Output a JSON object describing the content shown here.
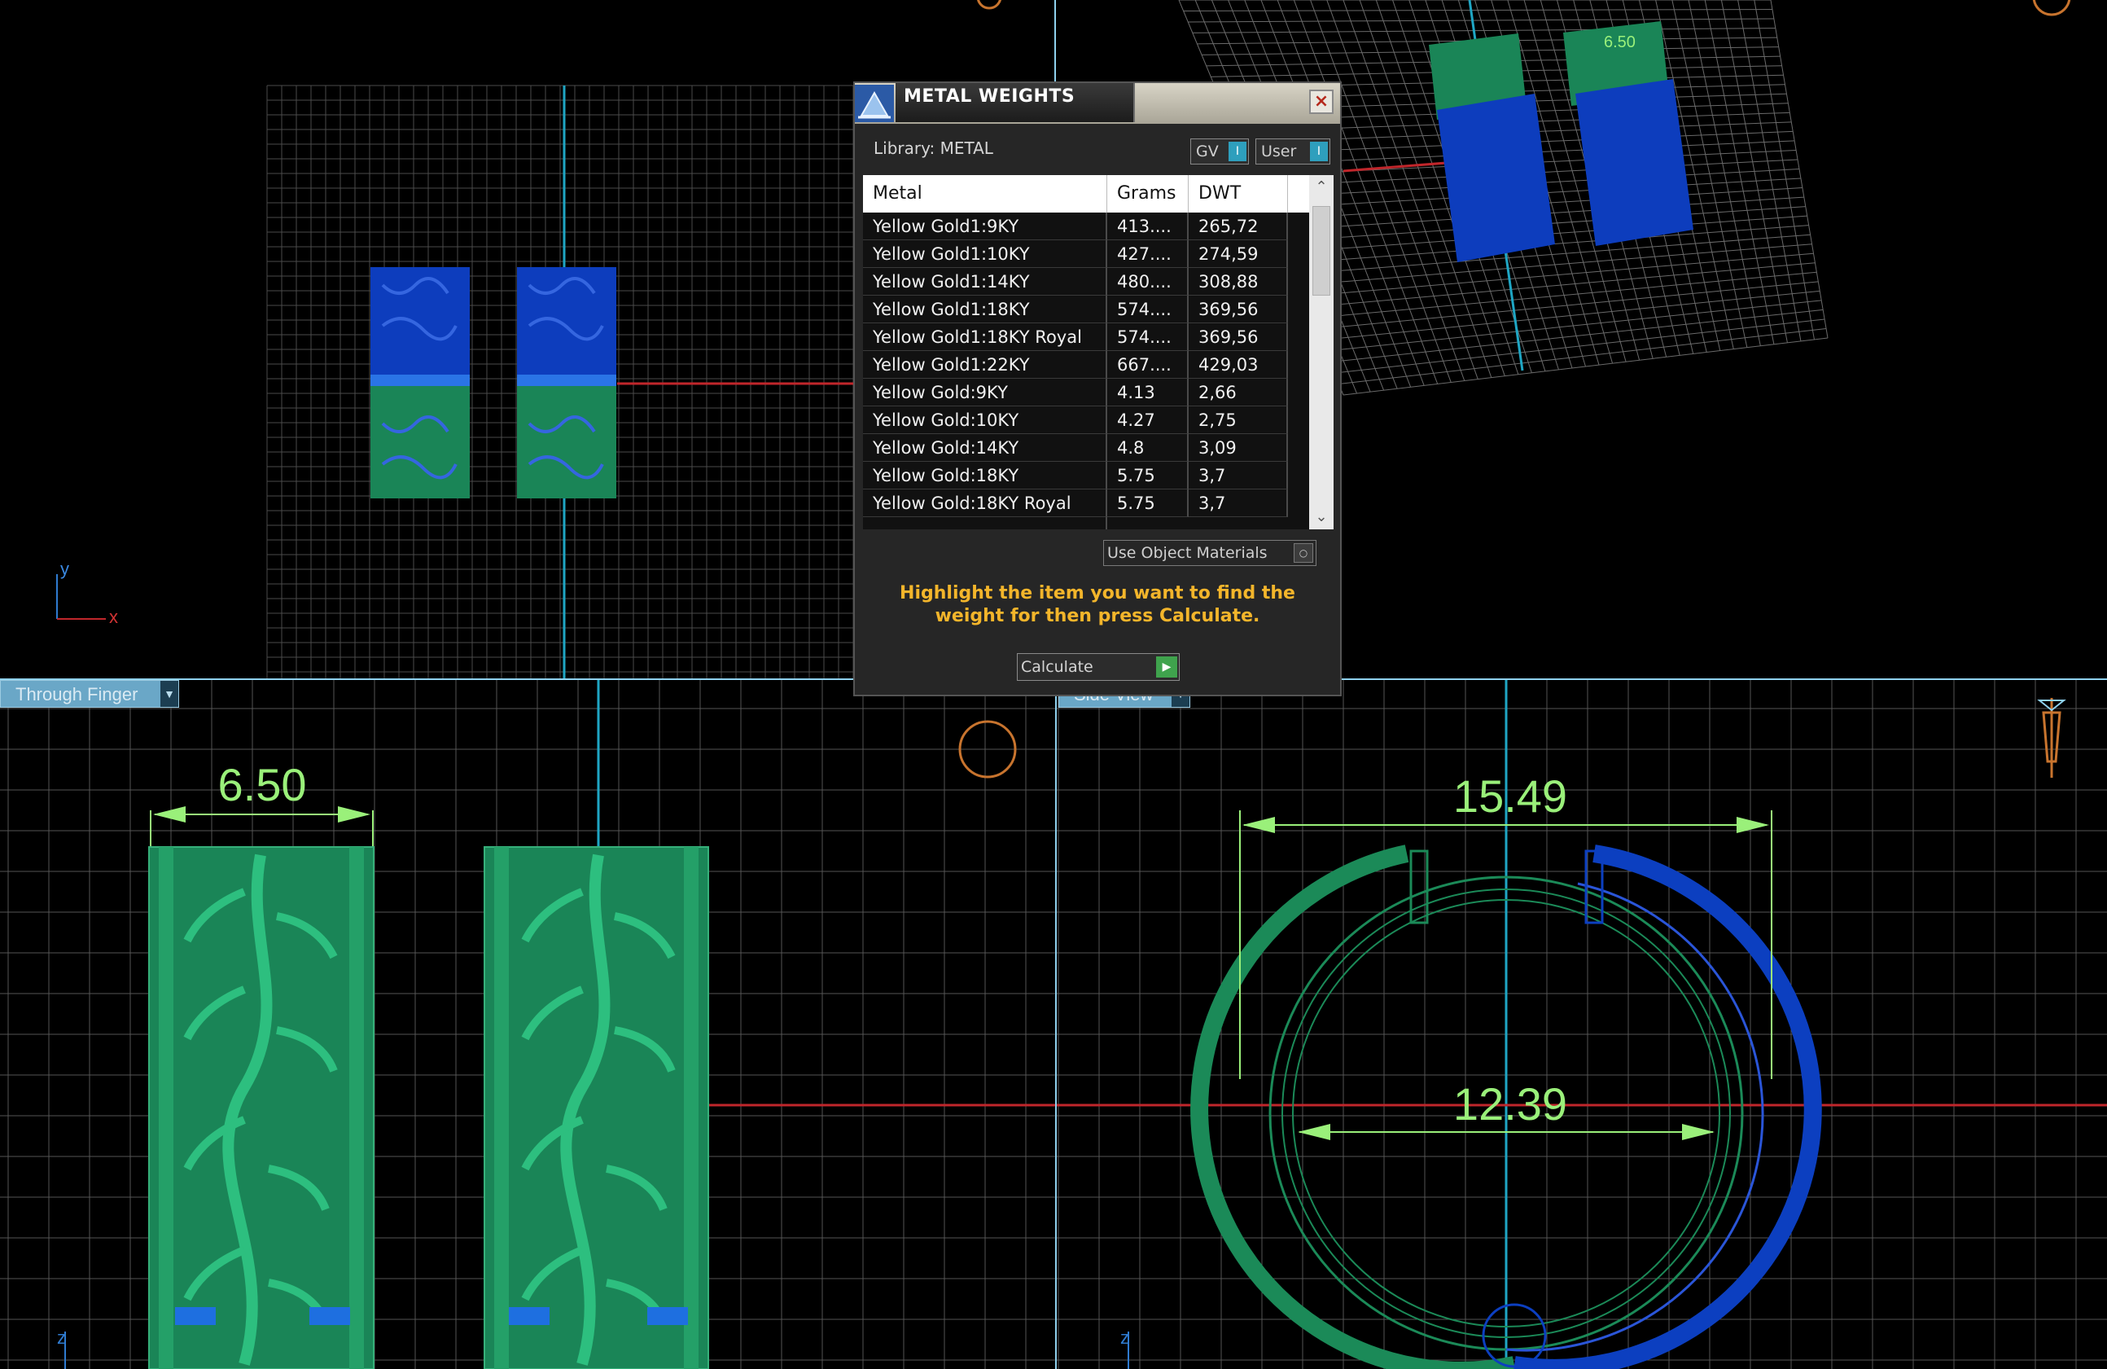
{
  "viewports": {
    "bottom_left": {
      "view_dropdown": "Through Finger",
      "width_dimension": "6.50",
      "axis_label_z": "z"
    },
    "bottom_right": {
      "view_dropdown": "Side View",
      "outer_dimension": "15.49",
      "inner_dimension": "12.39",
      "axis_label_z": "z"
    },
    "top_left": {
      "axis_label_x": "x",
      "axis_label_y": "y"
    },
    "top_right": {
      "small_dimension": "6.50"
    }
  },
  "dialog": {
    "title": "METAL WEIGHTS",
    "close_glyph": "×",
    "library_label": "Library: METAL",
    "toggle_gv": "GV",
    "toggle_user": "User",
    "toggle_glyph": "I",
    "columns": [
      "Metal",
      "Grams",
      "DWT"
    ],
    "rows": [
      {
        "metal": "Yellow Gold1:9KY",
        "grams": "413....",
        "dwt": "265,72"
      },
      {
        "metal": "Yellow Gold1:10KY",
        "grams": "427....",
        "dwt": "274,59"
      },
      {
        "metal": "Yellow Gold1:14KY",
        "grams": "480....",
        "dwt": "308,88"
      },
      {
        "metal": "Yellow Gold1:18KY",
        "grams": "574....",
        "dwt": "369,56"
      },
      {
        "metal": "Yellow Gold1:18KY Royal",
        "grams": "574....",
        "dwt": "369,56"
      },
      {
        "metal": "Yellow Gold1:22KY",
        "grams": "667....",
        "dwt": "429,03"
      },
      {
        "metal": "Yellow Gold:9KY",
        "grams": "4.13",
        "dwt": "2,66"
      },
      {
        "metal": "Yellow Gold:10KY",
        "grams": "4.27",
        "dwt": "2,75"
      },
      {
        "metal": "Yellow Gold:14KY",
        "grams": "4.8",
        "dwt": "3,09"
      },
      {
        "metal": "Yellow Gold:18KY",
        "grams": "5.75",
        "dwt": "3,7"
      },
      {
        "metal": "Yellow Gold:18KY Royal",
        "grams": "5.75",
        "dwt": "3,7"
      }
    ],
    "use_object_materials": "Use Object Materials",
    "hint": "Highlight the item you want to find the weight for then press Calculate.",
    "calculate_label": "Calculate",
    "calculate_glyph": "▶"
  },
  "colors": {
    "green_metal": "#1b8a58",
    "blue_metal": "#0c3fc0",
    "dimension": "#9af07a",
    "hint_text": "#f3b52b",
    "separator": "#8fd1ee"
  }
}
